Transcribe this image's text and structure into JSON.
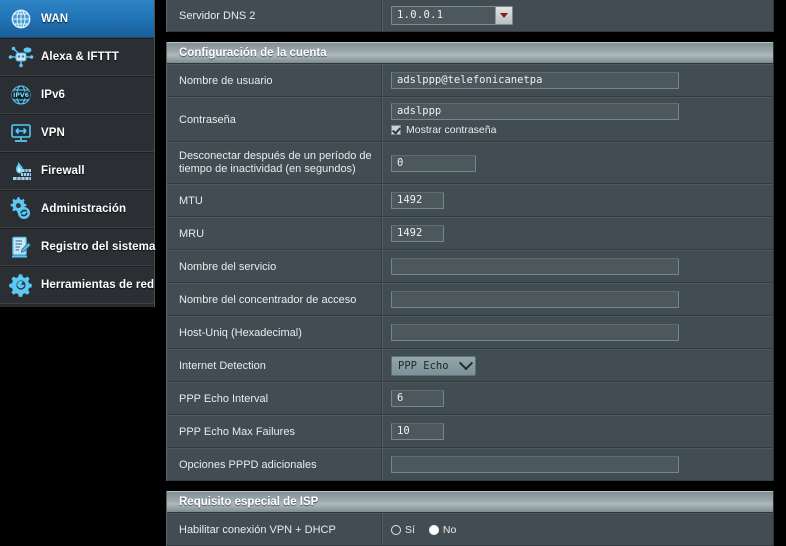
{
  "sidebar": {
    "items": [
      {
        "label": "WAN",
        "icon": "globe-icon",
        "active": true
      },
      {
        "label": "Alexa & IFTTT",
        "icon": "alexa-ifttt-icon",
        "active": false
      },
      {
        "label": "IPv6",
        "icon": "ipv6-globe-icon",
        "active": false
      },
      {
        "label": "VPN",
        "icon": "vpn-monitor-icon",
        "active": false
      },
      {
        "label": "Firewall",
        "icon": "firewall-flame-icon",
        "active": false
      },
      {
        "label": "Administración",
        "icon": "gear-refresh-icon",
        "active": false
      },
      {
        "label": "Registro del sistema",
        "icon": "log-document-icon",
        "active": false
      },
      {
        "label": "Herramientas de red",
        "icon": "gear-wrench-icon",
        "active": false
      }
    ]
  },
  "main": {
    "dns_row": {
      "label": "Servidor DNS 2",
      "value": "1.0.0.1"
    },
    "account_section": {
      "title": "Configuración de la cuenta",
      "rows": [
        {
          "label": "Nombre de usuario",
          "value": "adslppp@telefonicanetpa",
          "type": "text-wide"
        },
        {
          "label": "Contraseña",
          "value": "adslppp",
          "type": "password-with-check",
          "checkbox_label": "Mostrar contraseña",
          "checked": true
        },
        {
          "label": "Desconectar después de un período de tiempo de inactividad (en segundos)",
          "value": "0",
          "type": "text-mid"
        },
        {
          "label": "MTU",
          "value": "1492",
          "type": "text-small"
        },
        {
          "label": "MRU",
          "value": "1492",
          "type": "text-small"
        },
        {
          "label": "Nombre del servicio",
          "value": "",
          "type": "text-wide"
        },
        {
          "label": "Nombre del concentrador de acceso",
          "value": "",
          "type": "text-wide"
        },
        {
          "label": "Host-Uniq (Hexadecimal)",
          "value": "",
          "type": "text-wide"
        },
        {
          "label": "Internet Detection",
          "value": "PPP Echo",
          "type": "select"
        },
        {
          "label": "PPP Echo Interval",
          "value": "6",
          "type": "text-small"
        },
        {
          "label": "PPP Echo Max Failures",
          "value": "10",
          "type": "text-small"
        },
        {
          "label": "Opciones PPPD adicionales",
          "value": "",
          "type": "text-wide"
        }
      ]
    },
    "isp_section": {
      "title": "Requisito especial de ISP",
      "rows": [
        {
          "label": "Habilitar conexión VPN + DHCP",
          "type": "radio",
          "options": [
            {
              "label": "Sí",
              "selected": false
            },
            {
              "label": "No",
              "selected": true
            }
          ]
        }
      ]
    }
  },
  "colors": {
    "panel_bg": "#3f4b4f",
    "row_bg": "#414d52",
    "accent_blue": "#2176b8",
    "icon_blue": "#5bc8f5",
    "header_gray": "#9aa6aa",
    "dropdown_arrow_red": "#8e1b1b"
  }
}
